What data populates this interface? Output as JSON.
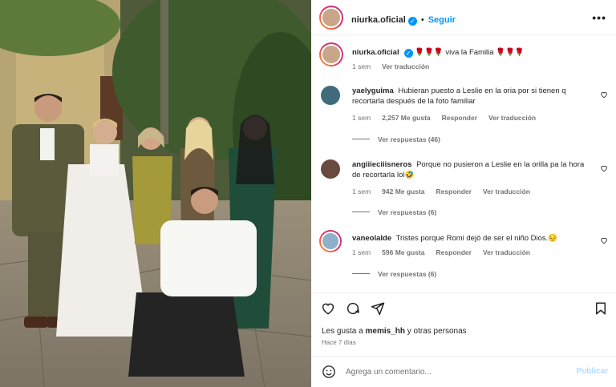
{
  "post": {
    "author": "niurka.oficial",
    "follow_label": "Seguir",
    "separator": "•",
    "more_label": "•••"
  },
  "caption": {
    "author": "niurka.oficial",
    "text": "🌹🌹🌹 viva la Familia 🌹🌹🌹",
    "time": "1 sem",
    "translate": "Ver traducción"
  },
  "comments": [
    {
      "user": "yaelyguima",
      "text": "Hubieran puesto a Leslie en la oria por si tienen q recortarla después de la foto familiar",
      "time": "1 sem",
      "likes": "2,257 Me gusta",
      "reply": "Responder",
      "translate": "Ver traducción",
      "replies": "Ver respuestas (46)"
    },
    {
      "user": "angiiieciiisneros",
      "text": "Porque no pusieron a Leslie en la orilla pa la hora de recortarla lol🤣",
      "time": "1 sem",
      "likes": "942 Me gusta",
      "reply": "Responder",
      "translate": "Ver traducción",
      "replies": "Ver respuestas (6)"
    },
    {
      "user": "vaneolalde",
      "text": "Tristes porque Romi dejó de ser el niño Dios.😔",
      "time": "1 sem",
      "likes": "596 Me gusta",
      "reply": "Responder",
      "translate": "Ver traducción",
      "replies": "Ver respuestas (6)"
    }
  ],
  "likes": {
    "prefix": "Les gusta a",
    "user": "memis_hh",
    "suffix": "y otras personas"
  },
  "posted_ago": "Hace 7 días",
  "add_comment": {
    "placeholder": "Agrega un comentario...",
    "publish_label": "Publicar"
  },
  "icons": {
    "like": "heart-icon",
    "comment": "comment-icon",
    "share": "share-icon",
    "save": "bookmark-icon",
    "emoji": "emoji-icon",
    "verified": "verified-badge-icon",
    "comment_like": "heart-icon"
  },
  "colors": {
    "accent": "#0095f6",
    "muted": "#737373",
    "publish_disabled": "#b3dbff",
    "verified": "#0095f6"
  }
}
